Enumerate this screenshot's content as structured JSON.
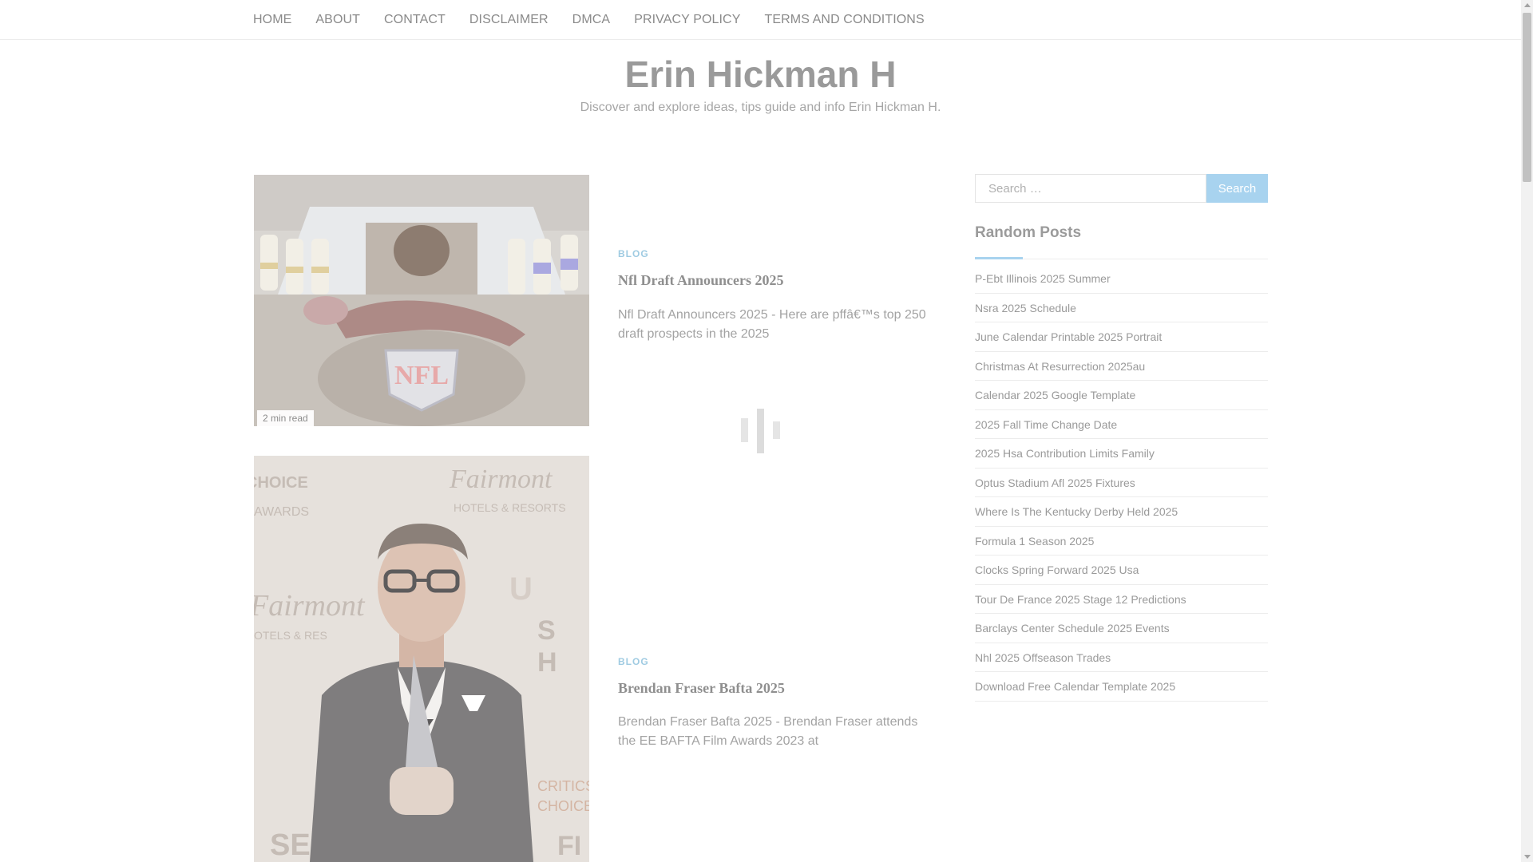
{
  "nav": {
    "items": [
      "HOME",
      "ABOUT",
      "CONTACT",
      "DISCLAIMER",
      "DMCA",
      "PRIVACY POLICY",
      "TERMS AND CONDITIONS"
    ]
  },
  "header": {
    "title": "Erin Hickman H",
    "description": "Discover and explore ideas, tips guide and info Erin Hickman H."
  },
  "posts": [
    {
      "category": "BLOG",
      "title": "Nfl Draft Announcers 2025",
      "excerpt": "Nfl Draft Announcers 2025 - Here are pffâ€™s top 250 draft prospects in the 2025",
      "read_time": "2 min read",
      "image_icon": "nfl-draft-stage-image"
    },
    {
      "category": "BLOG",
      "title": "Brendan Fraser Bafta 2025",
      "excerpt": "Brendan Fraser Bafta 2025 - Brendan Fraser attends the EE BAFTA Film Awards 2023 at",
      "image_icon": "brendan-fraser-award-image"
    }
  ],
  "sidebar": {
    "search": {
      "placeholder": "Search …",
      "button_label": "Search"
    },
    "random_posts": {
      "title": "Random Posts",
      "items": [
        "P-Ebt Illinois 2025 Summer",
        "Nsra 2025 Schedule",
        "June Calendar Printable 2025 Portrait",
        "Christmas At Resurrection 2025au",
        "Calendar 2025 Google Template",
        "2025 Fall Time Change Date",
        "2025 Hsa Contribution Limits Family",
        "Optus Stadium Afl 2025 Fixtures",
        "Where Is The Kentucky Derby Held 2025",
        "Formula 1 Season 2025",
        "Clocks Spring Forward 2025 Usa",
        "Tour De France 2025 Stage 12 Predictions",
        "Barclays Center Schedule 2025 Events",
        "Nhl 2025 Offseason Trades",
        "Download Free Calendar Template 2025"
      ]
    }
  },
  "colors": {
    "accent": "#a8d3ef",
    "category": "#9fcbe2",
    "text_muted": "#9a9a9a"
  }
}
